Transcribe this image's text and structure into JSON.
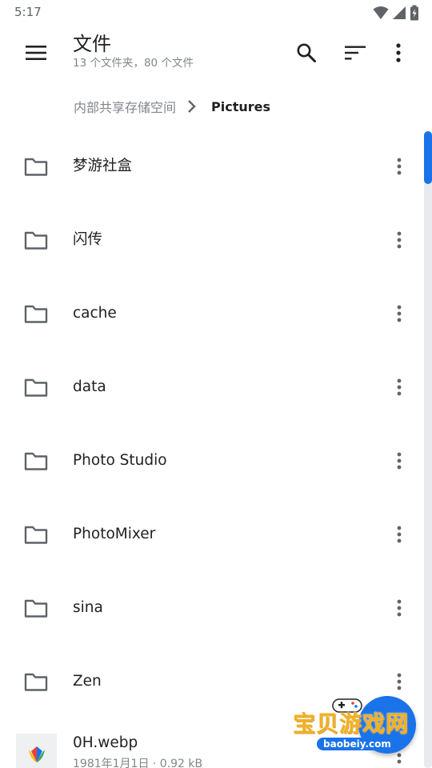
{
  "status_bar": {
    "time": "5:17"
  },
  "app_bar": {
    "title": "文件",
    "subtitle": "13 个文件夹，80 个文件"
  },
  "breadcrumb": {
    "root": "内部共享存储空间",
    "current": "Pictures"
  },
  "folders": [
    {
      "name": "梦游社盒"
    },
    {
      "name": "闪传"
    },
    {
      "name": "cache"
    },
    {
      "name": "data"
    },
    {
      "name": "Photo Studio"
    },
    {
      "name": "PhotoMixer"
    },
    {
      "name": "sina"
    },
    {
      "name": "Zen"
    }
  ],
  "files": [
    {
      "name": "0H.webp",
      "meta": "1981年1月1日 · 0.92 kB"
    }
  ],
  "watermark": {
    "title": "宝贝游戏网",
    "url": "baobeiy.com"
  },
  "colors": {
    "accent": "#1a73e8",
    "icon": "#5f6368",
    "secondary_text": "#80868b"
  },
  "icons": {
    "menu": "hamburger-icon",
    "search": "search-icon",
    "sort": "sort-icon",
    "more": "more-vert-icon",
    "folder": "folder-icon",
    "chevron": "chevron-right-icon"
  }
}
